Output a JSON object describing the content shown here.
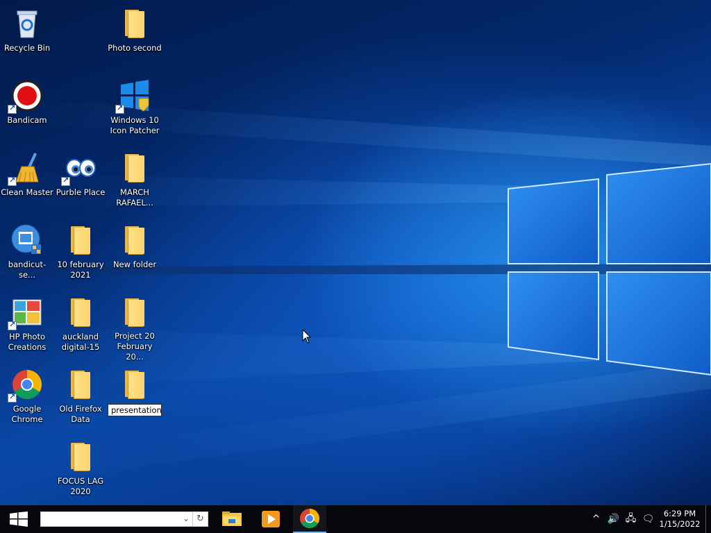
{
  "desktop": {
    "icons": [
      {
        "id": "recycle-bin",
        "label": "Recycle Bin"
      },
      {
        "id": "photo-second",
        "label": "Photo second"
      },
      {
        "id": "bandicam",
        "label": "Bandicam"
      },
      {
        "id": "windows-10-icon-patcher",
        "label": "Windows 10 Icon Patcher"
      },
      {
        "id": "clean-master",
        "label": "Clean Master"
      },
      {
        "id": "purble-place",
        "label": "Purble Place"
      },
      {
        "id": "march-rafael",
        "label": "MARCH RAFAEL..."
      },
      {
        "id": "bandicut",
        "label": "bandicut-se..."
      },
      {
        "id": "10-february-2021",
        "label": "10 february 2021"
      },
      {
        "id": "new-folder",
        "label": "New folder"
      },
      {
        "id": "hp-photo-creations",
        "label": "HP Photo Creations"
      },
      {
        "id": "auckland-digital-15",
        "label": "auckland digital-15"
      },
      {
        "id": "project-20-february",
        "label": "Project 20 February 20..."
      },
      {
        "id": "google-chrome",
        "label": "Google Chrome"
      },
      {
        "id": "old-firefox-data",
        "label": "Old Firefox Data"
      },
      {
        "id": "presentation",
        "label": "presentation"
      },
      {
        "id": "focus-lag-2020",
        "label": "FOCUS LAG 2020"
      }
    ]
  },
  "taskbar": {
    "search_value": "",
    "pinned": [
      {
        "name": "file-explorer",
        "icon": "folder-icon"
      },
      {
        "name": "media-player",
        "icon": "play-icon"
      },
      {
        "name": "google-chrome",
        "icon": "chrome-icon",
        "active": true
      }
    ],
    "tray": {
      "chevron": "^",
      "volume": "🔊",
      "network": "🖧",
      "notifications": "🗨"
    },
    "clock": {
      "time": "6:29 PM",
      "date": "1/15/2022"
    }
  },
  "colors": {
    "taskbar_bg": "#05070c",
    "wallpaper_blue": "#0a48a8",
    "folder_yellow": "#fcd36b",
    "active_indicator": "#76b9ed"
  }
}
